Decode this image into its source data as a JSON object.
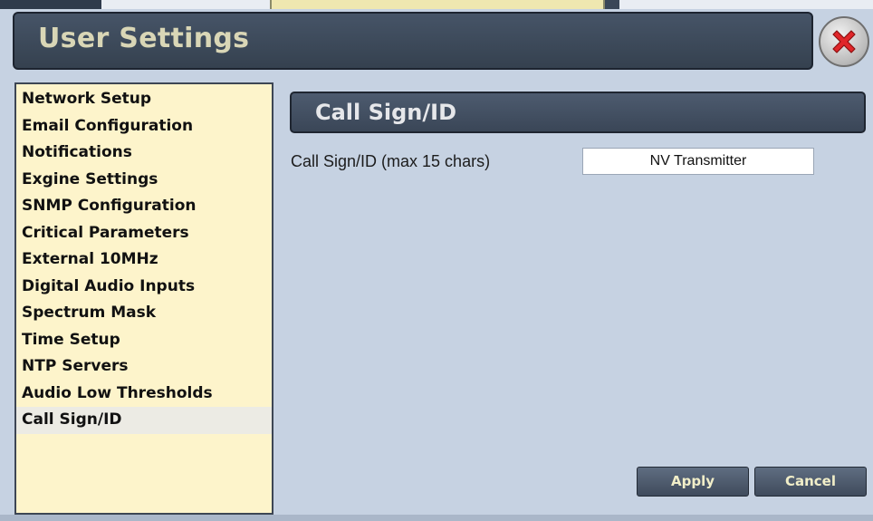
{
  "window": {
    "title": "User Settings",
    "close_icon": "close-x-icon",
    "accent_color": "#3b4758",
    "close_color": "#e0262a"
  },
  "sidebar": {
    "items": [
      {
        "label": "Network Setup"
      },
      {
        "label": "Email Configuration"
      },
      {
        "label": "Notifications"
      },
      {
        "label": "Exgine Settings"
      },
      {
        "label": "SNMP Configuration"
      },
      {
        "label": "Critical Parameters"
      },
      {
        "label": "External 10MHz"
      },
      {
        "label": "Digital Audio Inputs"
      },
      {
        "label": "Spectrum Mask"
      },
      {
        "label": "Time Setup"
      },
      {
        "label": "NTP Servers"
      },
      {
        "label": "Audio Low Thresholds"
      },
      {
        "label": "Call Sign/ID"
      }
    ],
    "selected": "Call Sign/ID"
  },
  "main": {
    "section_title": "Call Sign/ID",
    "field": {
      "label": "Call Sign/ID (max 15 chars)",
      "value": "NV Transmitter"
    },
    "buttons": {
      "apply": "Apply",
      "cancel": "Cancel"
    }
  }
}
